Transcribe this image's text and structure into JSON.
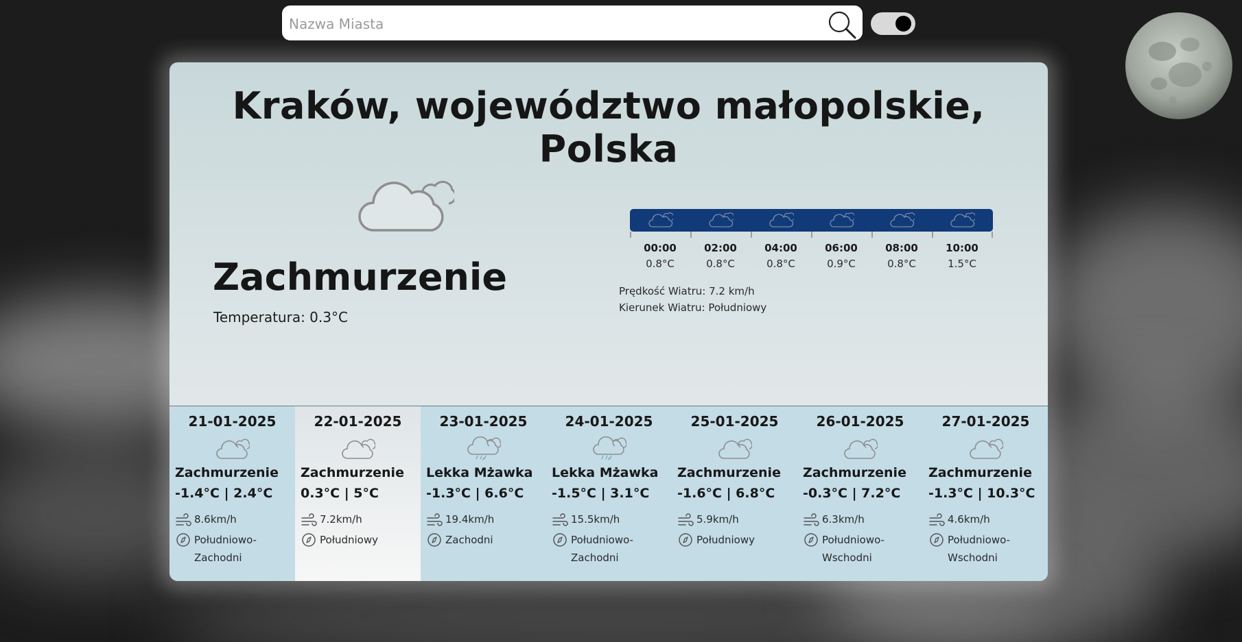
{
  "search": {
    "placeholder": "Nazwa Miasta"
  },
  "theme_toggle": {
    "state": "on"
  },
  "current": {
    "title": "Kraków, województwo małopolskie, Polska",
    "condition": "Zachmurzenie",
    "temperature": "Temperatura: 0.3°C",
    "icon": "cloud-icon",
    "wind_speed": "Prędkość Wiatru: 7.2 km/h",
    "wind_direction": "Kierunek Wiatru: Południowy"
  },
  "hourly": [
    {
      "time": "00:00",
      "temp": "0.8°C",
      "icon": "cloud-icon"
    },
    {
      "time": "02:00",
      "temp": "0.8°C",
      "icon": "cloud-icon"
    },
    {
      "time": "04:00",
      "temp": "0.8°C",
      "icon": "cloud-icon"
    },
    {
      "time": "06:00",
      "temp": "0.9°C",
      "icon": "cloud-icon"
    },
    {
      "time": "08:00",
      "temp": "0.8°C",
      "icon": "cloud-icon"
    },
    {
      "time": "10:00",
      "temp": "1.5°C",
      "icon": "cloud-icon"
    }
  ],
  "forecast": [
    {
      "date": "21-01-2025",
      "condition": "Zachmurzenie",
      "temps": "-1.4°C | 2.4°C",
      "wind": "8.6km/h",
      "direction": "Południowo-Zachodni",
      "icon": "cloud-icon",
      "selected": false
    },
    {
      "date": "22-01-2025",
      "condition": "Zachmurzenie",
      "temps": "0.3°C | 5°C",
      "wind": "7.2km/h",
      "direction": "Południowy",
      "icon": "cloud-icon",
      "selected": true
    },
    {
      "date": "23-01-2025",
      "condition": "Lekka Mżawka",
      "temps": "-1.3°C | 6.6°C",
      "wind": "19.4km/h",
      "direction": "Zachodni",
      "icon": "drizzle-icon",
      "selected": false
    },
    {
      "date": "24-01-2025",
      "condition": "Lekka Mżawka",
      "temps": "-1.5°C | 3.1°C",
      "wind": "15.5km/h",
      "direction": "Południowo-Zachodni",
      "icon": "drizzle-icon",
      "selected": false
    },
    {
      "date": "25-01-2025",
      "condition": "Zachmurzenie",
      "temps": "-1.6°C | 6.8°C",
      "wind": "5.9km/h",
      "direction": "Południowy",
      "icon": "cloud-icon",
      "selected": false
    },
    {
      "date": "26-01-2025",
      "condition": "Zachmurzenie",
      "temps": "-0.3°C | 7.2°C",
      "wind": "6.3km/h",
      "direction": "Południowo-Wschodni",
      "icon": "cloud-icon",
      "selected": false
    },
    {
      "date": "27-01-2025",
      "condition": "Zachmurzenie",
      "temps": "-1.3°C | 10.3°C",
      "wind": "4.6km/h",
      "direction": "Południowo-Wschodni",
      "icon": "cloud-icon",
      "selected": false
    }
  ],
  "colors": {
    "background": "#1c1c1c",
    "hourly_bar": "#113a78",
    "forecast_bg": "#c4dce6",
    "text": "#161616"
  }
}
